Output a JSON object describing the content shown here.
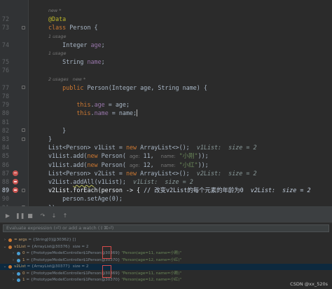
{
  "editor": {
    "lines": [
      {
        "num": "",
        "kind": "meta",
        "text": "new *"
      },
      {
        "num": "72",
        "kind": "code",
        "html": "<span class='ann'>@Data</span>"
      },
      {
        "num": "73",
        "kind": "code",
        "html": "<span class='kw'>class</span> Person {"
      },
      {
        "num": "",
        "kind": "meta",
        "text": "1 usage"
      },
      {
        "num": "74",
        "kind": "code",
        "html": "    Integer <span class='fld'>age</span>;"
      },
      {
        "num": "",
        "kind": "meta",
        "text": "1 usage"
      },
      {
        "num": "75",
        "kind": "code",
        "html": "    String <span class='fld'>name</span>;"
      },
      {
        "num": "76",
        "kind": "code",
        "html": ""
      },
      {
        "num": "",
        "kind": "meta",
        "text": "2 usages   new *"
      },
      {
        "num": "77",
        "kind": "code",
        "html": "    <span class='kw'>public</span> Person(Integer age, String name) {"
      },
      {
        "num": "78",
        "kind": "code",
        "html": ""
      },
      {
        "num": "79",
        "kind": "code",
        "html": "        <span class='kw'>this</span>.<span class='fld'>age</span> = age;"
      },
      {
        "num": "80",
        "kind": "code",
        "html": "        <span class='kw'>this</span>.<span class='fld'>name</span> = name;<span class='cursor'></span>"
      },
      {
        "num": "81",
        "kind": "code",
        "html": ""
      },
      {
        "num": "82",
        "kind": "code",
        "html": "    }"
      },
      {
        "num": "83",
        "kind": "code",
        "html": "}"
      },
      {
        "num": "84",
        "kind": "code",
        "html": "List&lt;Person&gt; v1List = <span class='kw'>new</span> ArrayList&lt;&gt;();  <span class='inl'>v1List:  size = 2</span>"
      },
      {
        "num": "85",
        "kind": "code",
        "html": "v1List.add(<span class='kw'>new</span> Person( <span class='hint'>age:</span> 11,  <span class='hint'>name:</span> <span class='str'>\"小刚\"</span>));"
      },
      {
        "num": "86",
        "kind": "code",
        "html": "v1List.add(<span class='kw'>new</span> Person( <span class='hint'>age:</span> 12,  <span class='hint'>name:</span> <span class='str'>\"小红\"</span>));"
      },
      {
        "num": "87",
        "kind": "bp",
        "html": "List&lt;Person&gt; v2List = <span class='kw'>new</span> ArrayList&lt;&gt;();  <span class='inl'>v2List:  size = 2</span>"
      },
      {
        "num": "88",
        "kind": "bp",
        "html": "v2List.<span class='underline'>addAll</span>(v1List);  <span class='inl'>v1List:  size = 2</span>"
      },
      {
        "num": "89",
        "kind": "cur",
        "html": "v2List.forEach(person -&gt; { <span class='cmt'>// 改变v2List的每个元素的年龄为0</span>  <span class='inl'>v2List:  size = 2</span>"
      },
      {
        "num": "90",
        "kind": "code",
        "html": "    person.setAge(0);"
      },
      {
        "num": "91",
        "kind": "code",
        "html": "});"
      },
      {
        "num": "92",
        "kind": "code",
        "html": ""
      }
    ]
  },
  "debugger": {
    "eval_placeholder": "Evaluate expression (⏎) or add a watch (⇧⌘⏎)",
    "rows": [
      {
        "indent": 0,
        "arrow": "›",
        "icon": "#cc7832",
        "name": "= args",
        "ref": "= {String[0]@30362} []",
        "val": "",
        "sel": false
      },
      {
        "indent": 0,
        "arrow": "⌄",
        "icon": "#cc7832",
        "name": "v1List",
        "ref": "= {ArrayList@30376}  size = 2",
        "val": "",
        "sel": false
      },
      {
        "indent": 1,
        "arrow": "›",
        "icon": "#4a9fd5",
        "name": "0",
        "ref": "= {PrototypeModelController$1Person@30369}",
        "val": "\"Person(age=11, name=小刚)\"",
        "sel": false
      },
      {
        "indent": 1,
        "arrow": "›",
        "icon": "#4a9fd5",
        "name": "1",
        "ref": "= {PrototypeModelController$1Person@30370}",
        "val": "\"Person(age=12, name=小红)\"",
        "sel": false
      },
      {
        "indent": 0,
        "arrow": "⌄",
        "icon": "#cc7832",
        "name": "v2List",
        "ref": "= {ArrayList@30377}  size = 2",
        "val": "",
        "sel": true
      },
      {
        "indent": 1,
        "arrow": "›",
        "icon": "#4a9fd5",
        "name": "0",
        "ref": "= {PrototypeModelController$1Person@30369}",
        "val": "\"Person(age=11, name=小刚)\"",
        "sel": false
      },
      {
        "indent": 1,
        "arrow": "›",
        "icon": "#4a9fd5",
        "name": "1",
        "ref": "= {PrototypeModelController$1Person@30370}",
        "val": "\"Person(age=12, name=小红)\"",
        "sel": false
      }
    ]
  },
  "watermark": "CSDN @xx_520s"
}
